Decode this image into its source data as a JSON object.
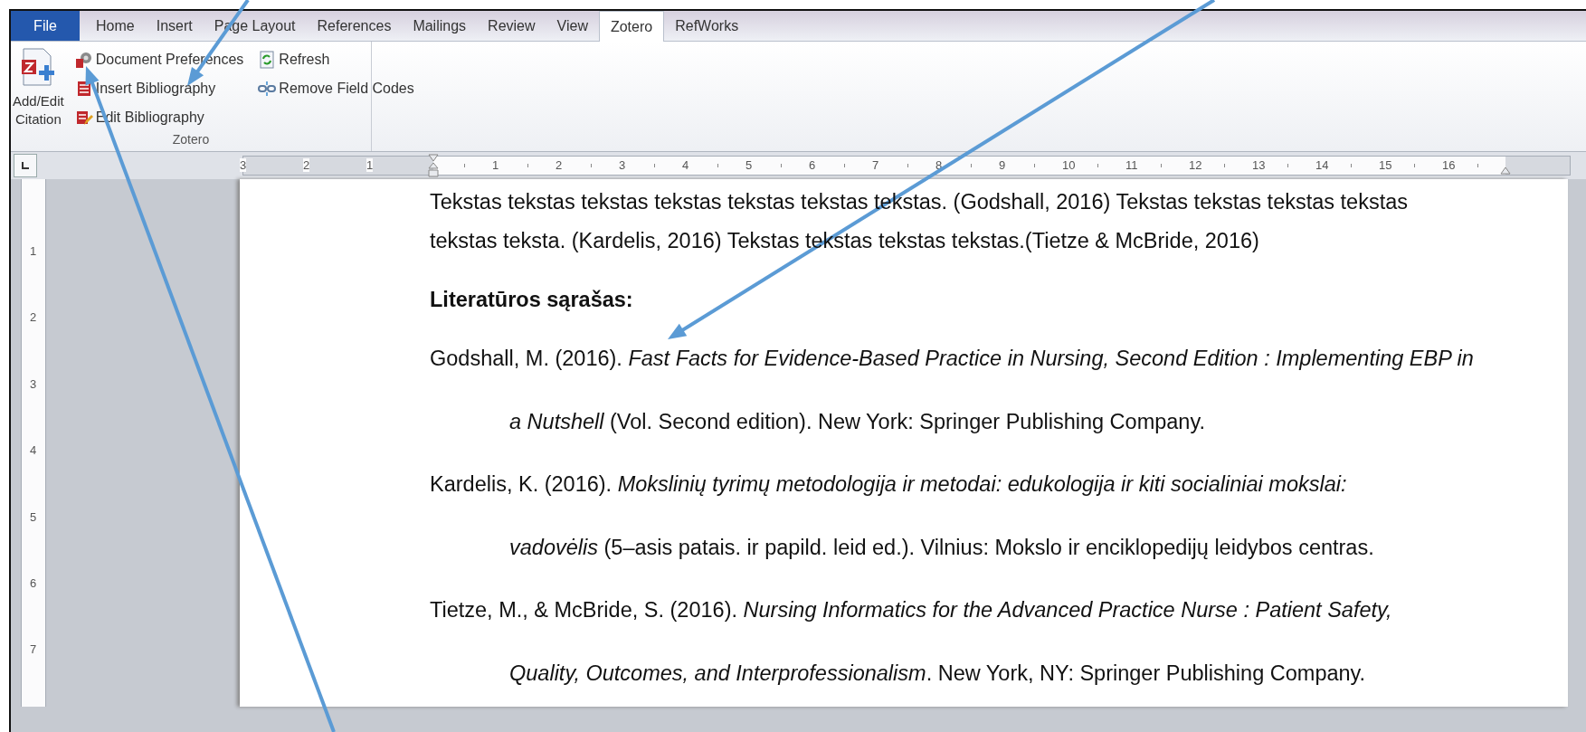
{
  "tabs": [
    {
      "label": "File",
      "kind": "file",
      "selected": false
    },
    {
      "label": "Home",
      "kind": "tab",
      "selected": false
    },
    {
      "label": "Insert",
      "kind": "tab",
      "selected": false
    },
    {
      "label": "Page Layout",
      "kind": "tab",
      "selected": false
    },
    {
      "label": "References",
      "kind": "tab",
      "selected": false
    },
    {
      "label": "Mailings",
      "kind": "tab",
      "selected": false
    },
    {
      "label": "Review",
      "kind": "tab",
      "selected": false
    },
    {
      "label": "View",
      "kind": "tab",
      "selected": false
    },
    {
      "label": "Zotero",
      "kind": "tab",
      "selected": true
    },
    {
      "label": "RefWorks",
      "kind": "tab",
      "selected": false
    }
  ],
  "ribbon": {
    "group_label": "Zotero",
    "large_button": {
      "label": "Add/Edit Citation"
    },
    "columns": [
      [
        {
          "label": "Document Preferences",
          "kind": "gear"
        },
        {
          "label": "Insert Bibliography",
          "kind": "insert"
        },
        {
          "label": "Edit Bibliography",
          "kind": "edit"
        }
      ],
      [
        {
          "label": "Refresh",
          "kind": "refresh"
        },
        {
          "label": "Remove Field Codes",
          "kind": "unlink"
        }
      ]
    ]
  },
  "ruler": {
    "left_labels": [
      "3",
      "2",
      "1"
    ],
    "right_labels": [
      "1",
      "2",
      "3",
      "4",
      "5",
      "6",
      "7",
      "8",
      "9",
      "10",
      "11",
      "12",
      "13",
      "14",
      "15",
      "16"
    ]
  },
  "vertical_ruler": {
    "labels": [
      "1",
      "2",
      "3",
      "4",
      "5",
      "6",
      "7"
    ]
  },
  "document": {
    "paragraphs": [
      {
        "kind": "body",
        "lines": [
          "Tekstas tekstas tekstas tekstas tekstas tekstas tekstas. (Godshall, 2016) Tekstas tekstas tekstas tekstas",
          "tekstas teksta. (Kardelis, 2016) Tekstas tekstas tekstas tekstas.(Tietze & McBride, 2016)"
        ]
      },
      {
        "kind": "heading",
        "lines": [
          "Literatūros sąrašas:"
        ]
      },
      {
        "kind": "reference",
        "lines": [
          "Godshall, M. (2016). *Fast Facts for Evidence-Based Practice in Nursing, Second Edition : Implementing EBP in*",
          "*a Nutshell* (Vol. Second edition). New York: Springer Publishing Company."
        ]
      },
      {
        "kind": "reference",
        "lines": [
          "Kardelis, K. (2016). *Mokslinių tyrimų metodologija ir metodai: edukologija ir kiti socialiniai mokslai:*",
          "*vadovėlis* (5–asis patais. ir papild. leid ed.). Vilnius: Mokslo ir enciklopedijų leidybos centras."
        ]
      },
      {
        "kind": "reference",
        "lines": [
          "Tietze, M., & McBride, S. (2016). *Nursing Informatics for the Advanced Practice Nurse : Patient Safety,*",
          "*Quality, Outcomes, and Interprofessionalism*. New York, NY: Springer Publishing Company."
        ]
      }
    ]
  }
}
